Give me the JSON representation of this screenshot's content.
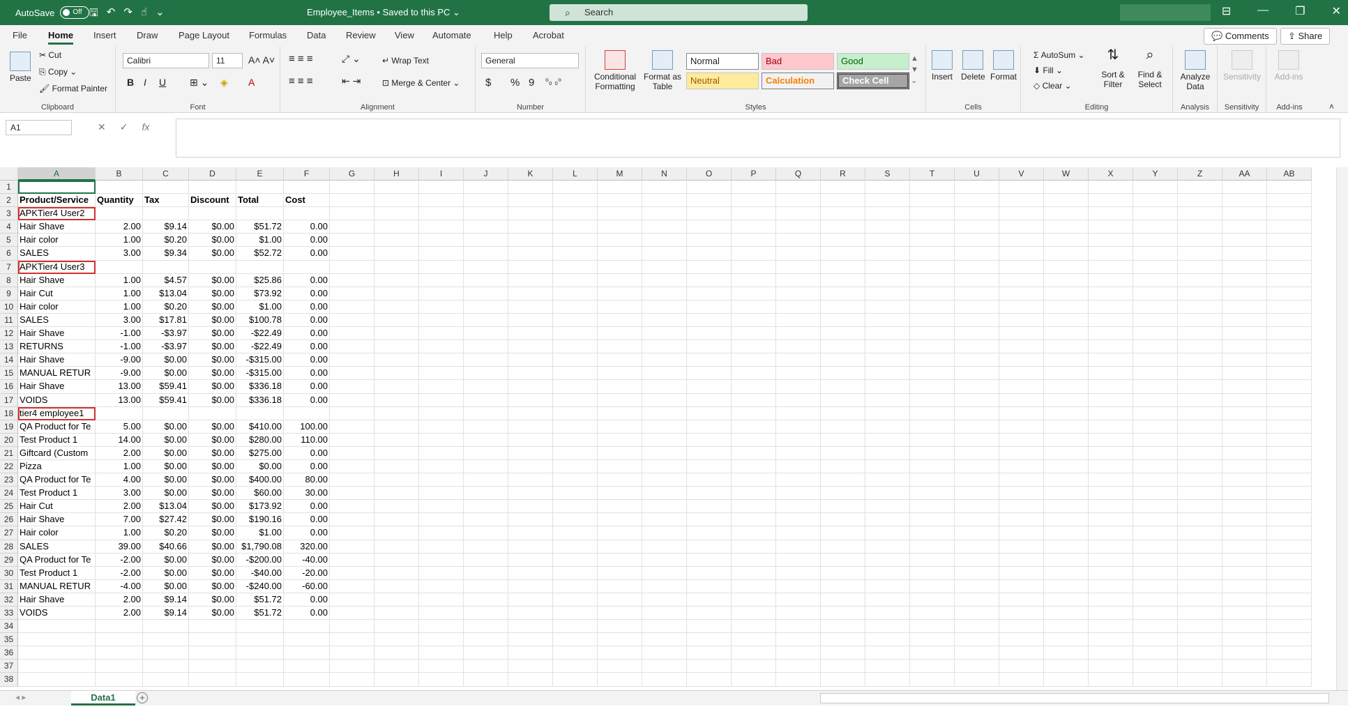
{
  "titlebar": {
    "autosave_label": "AutoSave",
    "autosave_state": "Off",
    "document": "Employee_Items • Saved to this PC ⌄",
    "search_placeholder": "Search"
  },
  "tabs": [
    "File",
    "Home",
    "Insert",
    "Draw",
    "Page Layout",
    "Formulas",
    "Data",
    "Review",
    "View",
    "Automate",
    "Help",
    "Acrobat"
  ],
  "tab_buttons": {
    "comments": "Comments",
    "share": "Share"
  },
  "ribbon": {
    "clipboard": {
      "paste": "Paste",
      "cut": "Cut",
      "copy": "Copy",
      "format_painter": "Format Painter",
      "label": "Clipboard"
    },
    "font": {
      "name": "Calibri",
      "size": "11",
      "bold": "B",
      "italic": "I",
      "underline": "U",
      "label": "Font"
    },
    "alignment": {
      "wrap": "Wrap Text",
      "merge": "Merge & Center",
      "label": "Alignment"
    },
    "number": {
      "format": "General",
      "currency": "$",
      "percent": "%",
      "comma": "9",
      "label": "Number"
    },
    "styles": {
      "conditional": "Conditional Formatting",
      "format_table": "Format as Table",
      "normal": "Normal",
      "bad": "Bad",
      "good": "Good",
      "neutral": "Neutral",
      "calculation": "Calculation",
      "check_cell": "Check Cell",
      "label": "Styles"
    },
    "cells": {
      "insert": "Insert",
      "delete": "Delete",
      "format": "Format",
      "label": "Cells"
    },
    "editing": {
      "autosum": "AutoSum",
      "fill": "Fill",
      "clear": "Clear",
      "sort": "Sort & Filter",
      "find": "Find & Select",
      "label": "Editing"
    },
    "analysis": {
      "analyze": "Analyze Data",
      "label": "Analysis"
    },
    "sensitivity": {
      "btn": "Sensitivity",
      "label": "Sensitivity"
    },
    "addins": {
      "btn": "Add-ins",
      "label": "Add-ins"
    }
  },
  "formula_bar": {
    "name_box": "A1",
    "fx": "fx",
    "value": ""
  },
  "columns": [
    "A",
    "B",
    "C",
    "D",
    "E",
    "F",
    "G",
    "H",
    "I",
    "J",
    "K",
    "L",
    "M",
    "N",
    "O",
    "P",
    "Q",
    "R",
    "S",
    "T",
    "U",
    "V",
    "W",
    "X",
    "Y",
    "Z",
    "AA",
    "AB"
  ],
  "rows": [
    [
      "",
      "",
      "",
      "",
      "",
      ""
    ],
    [
      "Product/Service",
      "Quantity",
      "Tax",
      "Discount",
      "Total",
      "Cost"
    ],
    [
      "APKTier4 User2",
      "",
      "",
      "",
      "",
      ""
    ],
    [
      "Hair Shave",
      "2.00",
      "$9.14",
      "$0.00",
      "$51.72",
      "0.00"
    ],
    [
      "Hair color",
      "1.00",
      "$0.20",
      "$0.00",
      "$1.00",
      "0.00"
    ],
    [
      "   SALES",
      "3.00",
      "$9.34",
      "$0.00",
      "$52.72",
      "0.00"
    ],
    [
      "APKTier4 User3",
      "",
      "",
      "",
      "",
      ""
    ],
    [
      "Hair Shave",
      "1.00",
      "$4.57",
      "$0.00",
      "$25.86",
      "0.00"
    ],
    [
      "Hair Cut",
      "1.00",
      "$13.04",
      "$0.00",
      "$73.92",
      "0.00"
    ],
    [
      "Hair color",
      "1.00",
      "$0.20",
      "$0.00",
      "$1.00",
      "0.00"
    ],
    [
      "   SALES",
      "3.00",
      "$17.81",
      "$0.00",
      "$100.78",
      "0.00"
    ],
    [
      "Hair Shave",
      "-1.00",
      "-$3.97",
      "$0.00",
      "-$22.49",
      "0.00"
    ],
    [
      "   RETURNS",
      "-1.00",
      "-$3.97",
      "$0.00",
      "-$22.49",
      "0.00"
    ],
    [
      "Hair Shave",
      "-9.00",
      "$0.00",
      "$0.00",
      "-$315.00",
      "0.00"
    ],
    [
      "   MANUAL RETUR",
      "-9.00",
      "$0.00",
      "$0.00",
      "-$315.00",
      "0.00"
    ],
    [
      "Hair Shave",
      "13.00",
      "$59.41",
      "$0.00",
      "$336.18",
      "0.00"
    ],
    [
      "   VOIDS",
      "13.00",
      "$59.41",
      "$0.00",
      "$336.18",
      "0.00"
    ],
    [
      "tier4 employee1",
      "",
      "",
      "",
      "",
      ""
    ],
    [
      "QA Product for Te",
      "5.00",
      "$0.00",
      "$0.00",
      "$410.00",
      "100.00"
    ],
    [
      "Test Product 1",
      "14.00",
      "$0.00",
      "$0.00",
      "$280.00",
      "110.00"
    ],
    [
      "Giftcard (Custom",
      "2.00",
      "$0.00",
      "$0.00",
      "$275.00",
      "0.00"
    ],
    [
      "Pizza",
      "1.00",
      "$0.00",
      "$0.00",
      "$0.00",
      "0.00"
    ],
    [
      "QA Product for Te",
      "4.00",
      "$0.00",
      "$0.00",
      "$400.00",
      "80.00"
    ],
    [
      "Test Product 1",
      "3.00",
      "$0.00",
      "$0.00",
      "$60.00",
      "30.00"
    ],
    [
      "Hair Cut",
      "2.00",
      "$13.04",
      "$0.00",
      "$173.92",
      "0.00"
    ],
    [
      "Hair Shave",
      "7.00",
      "$27.42",
      "$0.00",
      "$190.16",
      "0.00"
    ],
    [
      "Hair color",
      "1.00",
      "$0.20",
      "$0.00",
      "$1.00",
      "0.00"
    ],
    [
      "   SALES",
      "39.00",
      "$40.66",
      "$0.00",
      "$1,790.08",
      "320.00"
    ],
    [
      "QA Product for Te",
      "-2.00",
      "$0.00",
      "$0.00",
      "-$200.00",
      "-40.00"
    ],
    [
      "Test Product 1",
      "-2.00",
      "$0.00",
      "$0.00",
      "-$40.00",
      "-20.00"
    ],
    [
      "   MANUAL RETUR",
      "-4.00",
      "$0.00",
      "$0.00",
      "-$240.00",
      "-60.00"
    ],
    [
      "Hair Shave",
      "2.00",
      "$9.14",
      "$0.00",
      "$51.72",
      "0.00"
    ],
    [
      "   VOIDS",
      "2.00",
      "$9.14",
      "$0.00",
      "$51.72",
      "0.00"
    ],
    [
      "",
      "",
      "",
      "",
      "",
      ""
    ],
    [
      "",
      "",
      "",
      "",
      "",
      ""
    ],
    [
      "",
      "",
      "",
      "",
      "",
      ""
    ],
    [
      "",
      "",
      "",
      "",
      "",
      ""
    ],
    [
      "",
      "",
      "",
      "",
      "",
      ""
    ]
  ],
  "highlighted_rows": [
    3,
    7,
    18
  ],
  "sheet_tab": "Data1",
  "colors": {
    "accent": "#217346",
    "highlight": "#d32f2f"
  }
}
